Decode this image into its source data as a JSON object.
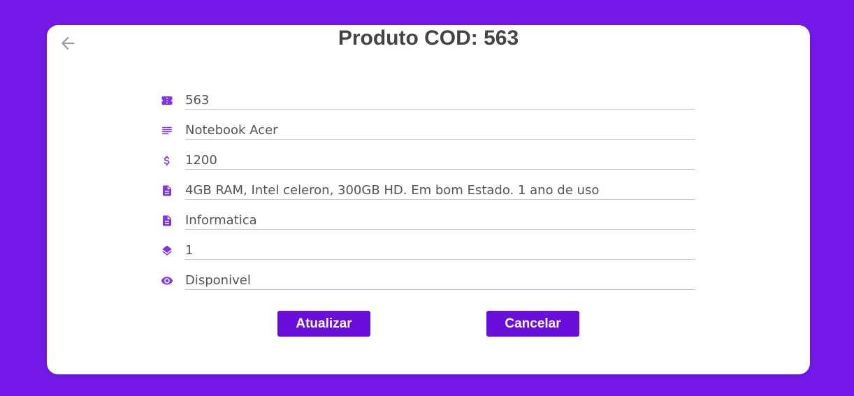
{
  "page": {
    "title": "Produto COD: 563"
  },
  "fields": [
    {
      "icon": "ticket-icon",
      "value": "563"
    },
    {
      "icon": "lines-icon",
      "value": "Notebook Acer"
    },
    {
      "icon": "dollar-icon",
      "value": "1200"
    },
    {
      "icon": "document-icon",
      "value": "4GB RAM, Intel celeron, 300GB HD. Em bom Estado. 1 ano de uso"
    },
    {
      "icon": "document-icon",
      "value": "Informatica"
    },
    {
      "icon": "layers-icon",
      "value": "1"
    },
    {
      "icon": "eye-icon",
      "value": "Disponivel"
    }
  ],
  "buttons": {
    "update_label": "Atualizar",
    "cancel_label": "Cancelar"
  },
  "colors": {
    "background": "#7519ea",
    "accent": "#6a0fdb",
    "icon": "#8135e6"
  }
}
